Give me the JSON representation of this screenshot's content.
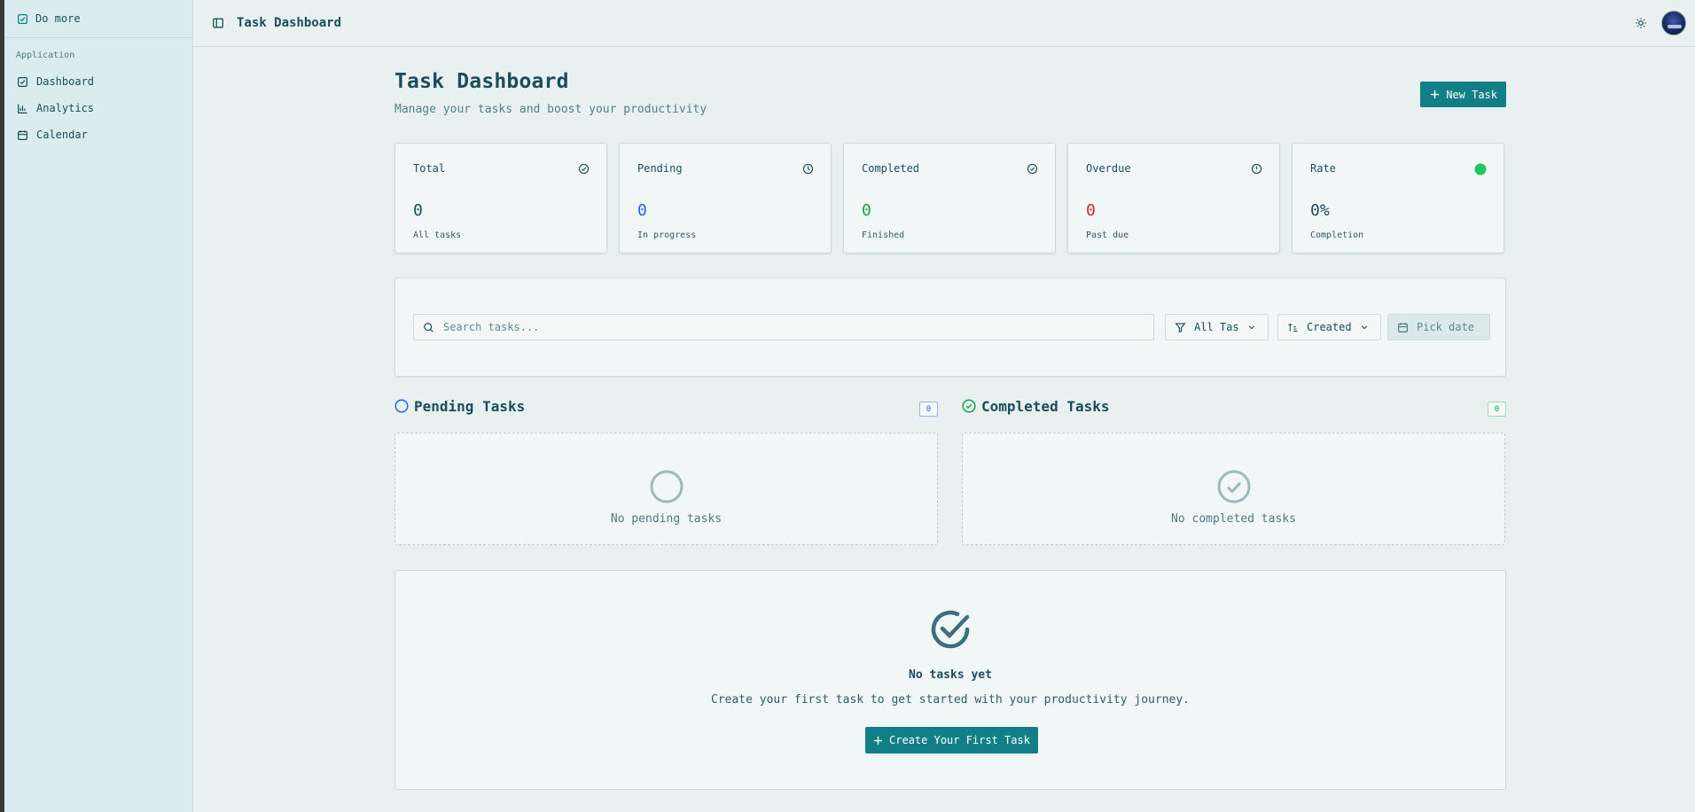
{
  "colors": {
    "accent": "#127f86",
    "pending_blue": "#2563eb",
    "completed_green": "#16a34a",
    "overdue_red": "#dc2626",
    "rate_dot": "#22c55e"
  },
  "sidebar": {
    "brand": {
      "label": "Do more",
      "icon": "check-square-icon"
    },
    "group_label": "Application",
    "items": [
      {
        "label": "Dashboard",
        "icon": "check-square-icon"
      },
      {
        "label": "Analytics",
        "icon": "bar-chart-icon"
      },
      {
        "label": "Calendar",
        "icon": "calendar-icon"
      }
    ]
  },
  "topbar": {
    "title": "Task Dashboard",
    "toggle_icon": "sidebar-toggle-icon",
    "theme_icon": "sun-icon"
  },
  "header": {
    "title": "Task Dashboard",
    "subtitle": "Manage your tasks and boost your productivity",
    "new_task_label": "New Task"
  },
  "stats": [
    {
      "label": "Total",
      "value": "0",
      "caption": "All tasks",
      "icon": "check-circle-icon"
    },
    {
      "label": "Pending",
      "value": "0",
      "caption": "In progress",
      "icon": "clock-icon"
    },
    {
      "label": "Completed",
      "value": "0",
      "caption": "Finished",
      "icon": "check-circle-icon"
    },
    {
      "label": "Overdue",
      "value": "0",
      "caption": "Past due",
      "icon": "alert-circle-icon"
    },
    {
      "label": "Rate",
      "value": "0%",
      "caption": "Completion",
      "icon": "status-dot-icon"
    }
  ],
  "filters": {
    "search_placeholder": "Search tasks...",
    "search_value": "",
    "type_select": "All Tas",
    "sort_select": "Created",
    "date_placeholder": "Pick date"
  },
  "columns": {
    "pending": {
      "title": "Pending Tasks",
      "count": "0",
      "empty_text": "No pending tasks"
    },
    "completed": {
      "title": "Completed Tasks",
      "count": "0",
      "empty_text": "No completed tasks"
    }
  },
  "empty_state": {
    "title": "No tasks yet",
    "description": "Create your first task to get started with your productivity journey.",
    "button_label": "Create Your First Task"
  }
}
